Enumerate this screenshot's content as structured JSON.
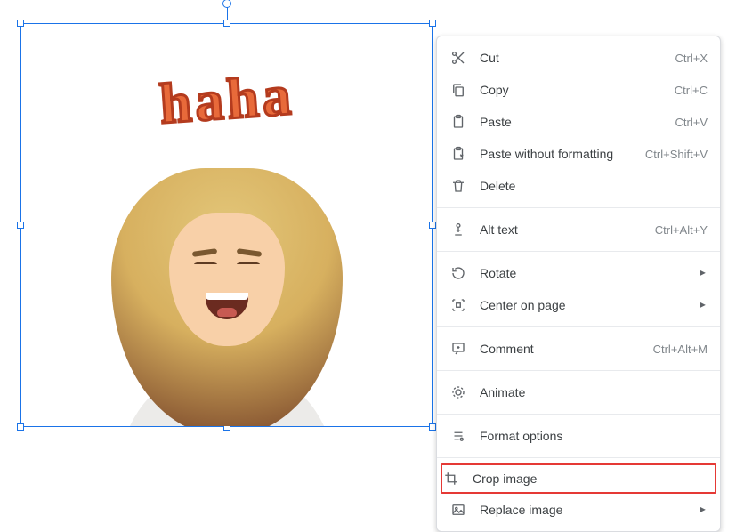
{
  "image": {
    "text": "haha"
  },
  "menu": {
    "items": [
      {
        "label": "Cut",
        "shortcut": "Ctrl+X",
        "icon": "cut-icon"
      },
      {
        "label": "Copy",
        "shortcut": "Ctrl+C",
        "icon": "copy-icon"
      },
      {
        "label": "Paste",
        "shortcut": "Ctrl+V",
        "icon": "paste-icon"
      },
      {
        "label": "Paste without formatting",
        "shortcut": "Ctrl+Shift+V",
        "icon": "paste-plain-icon"
      },
      {
        "label": "Delete",
        "shortcut": "",
        "icon": "delete-icon"
      }
    ],
    "group2": [
      {
        "label": "Alt text",
        "shortcut": "Ctrl+Alt+Y",
        "icon": "alt-text-icon"
      }
    ],
    "group3": [
      {
        "label": "Rotate",
        "submenu": true,
        "icon": "rotate-icon"
      },
      {
        "label": "Center on page",
        "submenu": true,
        "icon": "center-icon"
      }
    ],
    "group4": [
      {
        "label": "Comment",
        "shortcut": "Ctrl+Alt+M",
        "icon": "comment-icon"
      }
    ],
    "group5": [
      {
        "label": "Animate",
        "icon": "animate-icon"
      }
    ],
    "group6": [
      {
        "label": "Format options",
        "icon": "format-icon"
      }
    ],
    "group7": [
      {
        "label": "Crop image",
        "icon": "crop-icon"
      },
      {
        "label": "Replace image",
        "submenu": true,
        "icon": "replace-image-icon"
      }
    ]
  }
}
